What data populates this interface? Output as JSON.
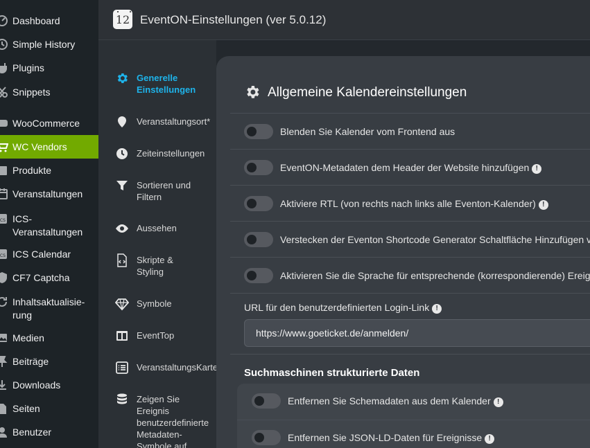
{
  "wp_sidebar": {
    "items": [
      {
        "label": "Dashboard",
        "icon": "dashboard-icon"
      },
      {
        "label": "Simple History",
        "icon": "history-icon"
      },
      {
        "label": "Plugins",
        "icon": "plugin-icon"
      },
      {
        "label": "Snippets",
        "icon": "scissors-icon"
      },
      {
        "label": "WooCommerce",
        "icon": "woocommerce-icon"
      },
      {
        "label": "WC Vendors",
        "icon": "cart-icon"
      },
      {
        "label": "Produkte",
        "icon": "product-icon"
      },
      {
        "label": "Veranstaltungen",
        "icon": "calendar-icon"
      },
      {
        "label": "ICS-\nVeranstaltungen",
        "icon": "ics-icon"
      },
      {
        "label": "ICS Calendar",
        "icon": "ics-icon"
      },
      {
        "label": "CF7 Captcha",
        "icon": "captcha-icon"
      },
      {
        "label": "Inhaltsaktualisie-\nrung",
        "icon": "update-icon"
      },
      {
        "label": "Medien",
        "icon": "media-icon"
      },
      {
        "label": "Beiträge",
        "icon": "pin-icon"
      },
      {
        "label": "Downloads",
        "icon": "download-icon"
      },
      {
        "label": "Seiten",
        "icon": "page-icon"
      },
      {
        "label": "Benutzer",
        "icon": "user-icon"
      }
    ],
    "active_color": "#72aa00"
  },
  "header": {
    "logo_text": "12",
    "title": "EventON-Einstellungen (ver 5.0.12)"
  },
  "nav": {
    "items": [
      {
        "label": "Generelle\nEinstellungen",
        "icon": "gear-icon",
        "active": true
      },
      {
        "label": "Veranstaltungsort*",
        "icon": "location-pin-icon"
      },
      {
        "label": "Zeiteinstellungen",
        "icon": "clock-icon"
      },
      {
        "label": "Sortieren und\nFiltern",
        "icon": "filter-icon"
      },
      {
        "label": "Aussehen",
        "icon": "eye-icon"
      },
      {
        "label": "Skripte &\nStyling",
        "icon": "code-file-icon"
      },
      {
        "label": "Symbole",
        "icon": "diamond-icon"
      },
      {
        "label": "EventTop",
        "icon": "columns-icon"
      },
      {
        "label": "VeranstaltungsKarte",
        "icon": "list-icon"
      },
      {
        "label": "Zeigen Sie\nEreignis\nbenutzerdefinierte\nMetadaten-\nSymbole auf",
        "icon": "database-icon"
      }
    ],
    "active_color": "#1eb3ea"
  },
  "main": {
    "title": "Allgemeine Kalendereinstellungen",
    "toggles": [
      {
        "label": "Blenden Sie Kalender vom Frontend aus",
        "info": false
      },
      {
        "label": "EventON-Metadaten dem Header der Website hinzufügen",
        "info": true
      },
      {
        "label": "Aktiviere RTL (von rechts nach links alle Eventon-Kalender)",
        "info": true
      },
      {
        "label": "Verstecken der Eventon Shortcode Generator Schaltfläche Hinzufügen vo",
        "info": false
      },
      {
        "label": "Aktivieren Sie die Sprache für entsprechende (korrespondierende) Ereign",
        "info": false
      }
    ],
    "url_field": {
      "label": "URL für den benutzerdefinierten Login-Link",
      "value": "https://www.goeticket.de/anmelden/"
    },
    "seo": {
      "title": "Suchmaschinen strukturierte Daten",
      "toggles": [
        {
          "label": "Entfernen Sie Schemadaten aus dem Kalender",
          "info": true
        },
        {
          "label": "Entfernen Sie JSON-LD-Daten für Ereignisse",
          "info": true
        }
      ]
    },
    "info_symbol": "!"
  }
}
